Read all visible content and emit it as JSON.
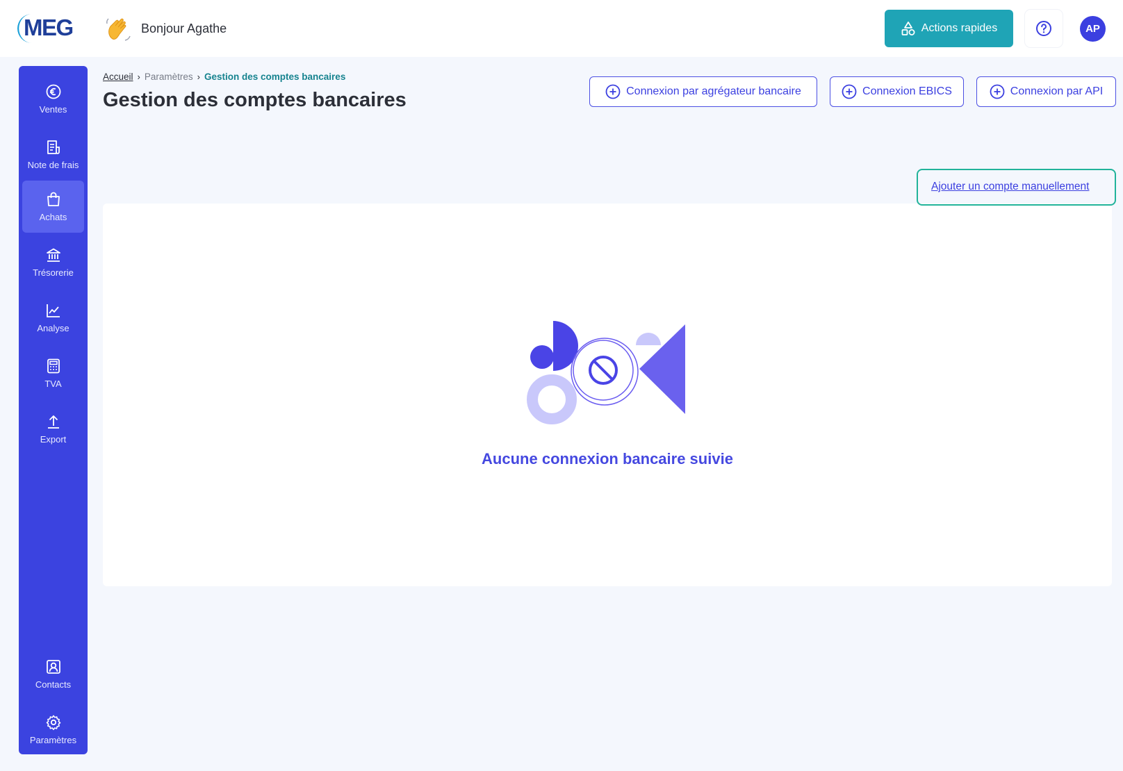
{
  "header": {
    "logo_text": "MEG",
    "greeting": "Bonjour Agathe",
    "quick_actions_label": "Actions rapides",
    "avatar_initials": "AP"
  },
  "sidebar": {
    "items": [
      {
        "label": "Ventes",
        "icon": "euro-icon"
      },
      {
        "label": "Note de frais",
        "icon": "receipt-icon"
      },
      {
        "label": "Achats",
        "icon": "shopping-bag-icon",
        "active": true
      },
      {
        "label": "Trésorerie",
        "icon": "bank-icon"
      },
      {
        "label": "Analyse",
        "icon": "chart-line-icon"
      },
      {
        "label": "TVA",
        "icon": "calculator-icon"
      },
      {
        "label": "Export",
        "icon": "upload-icon"
      },
      {
        "label": "Contacts",
        "icon": "contact-icon"
      },
      {
        "label": "Paramètres",
        "icon": "gear-icon"
      }
    ]
  },
  "breadcrumb": {
    "home": "Accueil",
    "parent": "Paramètres",
    "current": "Gestion des comptes bancaires"
  },
  "page": {
    "title": "Gestion des comptes bancaires",
    "connect_aggregator": "Connexion par agrégateur bancaire",
    "connect_ebics": "Connexion EBICS",
    "connect_api": "Connexion par API",
    "add_manual": "Ajouter un compte manuellement",
    "empty_message": "Aucune connexion bancaire suivie"
  },
  "colors": {
    "brand_primary": "#3b43e0",
    "accent_teal": "#1fa4b6",
    "highlight": "#21b39a"
  }
}
